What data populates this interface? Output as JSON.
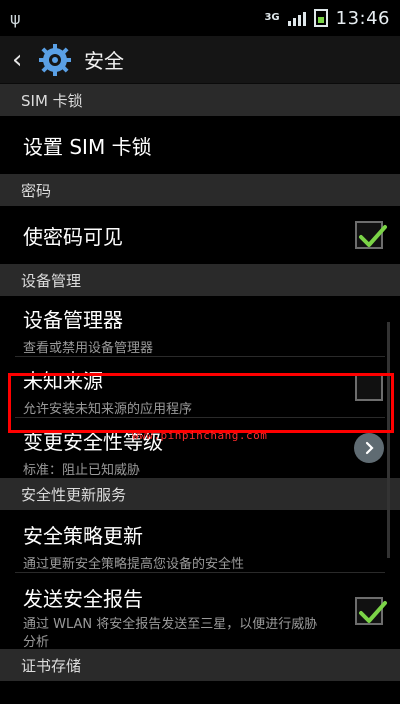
{
  "status_bar": {
    "network": "3G",
    "time": "13:46"
  },
  "action_bar": {
    "title": "安全"
  },
  "sections": [
    {
      "header": "SIM 卡锁",
      "items": [
        {
          "primary": "设置 SIM 卡锁"
        }
      ]
    },
    {
      "header": "密码",
      "items": [
        {
          "primary": "使密码可见",
          "checked": true
        }
      ]
    },
    {
      "header": "设备管理",
      "items": [
        {
          "primary": "设备管理器",
          "secondary": "查看或禁用设备管理器"
        },
        {
          "primary": "未知来源",
          "secondary": "允许安装未知来源的应用程序",
          "checked": false
        },
        {
          "primary": "变更安全性等级",
          "secondary": "标准：阻止已知威胁"
        }
      ]
    },
    {
      "header": "安全性更新服务",
      "items": [
        {
          "primary": "安全策略更新",
          "secondary": "通过更新安全策略提高您设备的安全性"
        },
        {
          "primary": "发送安全报告",
          "secondary": "通过 WLAN 将安全报告发送至三星，以便进行威胁分析",
          "checked": true
        }
      ]
    },
    {
      "header": "证书存储",
      "items": []
    }
  ],
  "watermark": "www.pinpinchang.com",
  "colors": {
    "check_green": "#7bd447",
    "highlight": "#ff0000",
    "watermark": "#ff2b2b"
  }
}
